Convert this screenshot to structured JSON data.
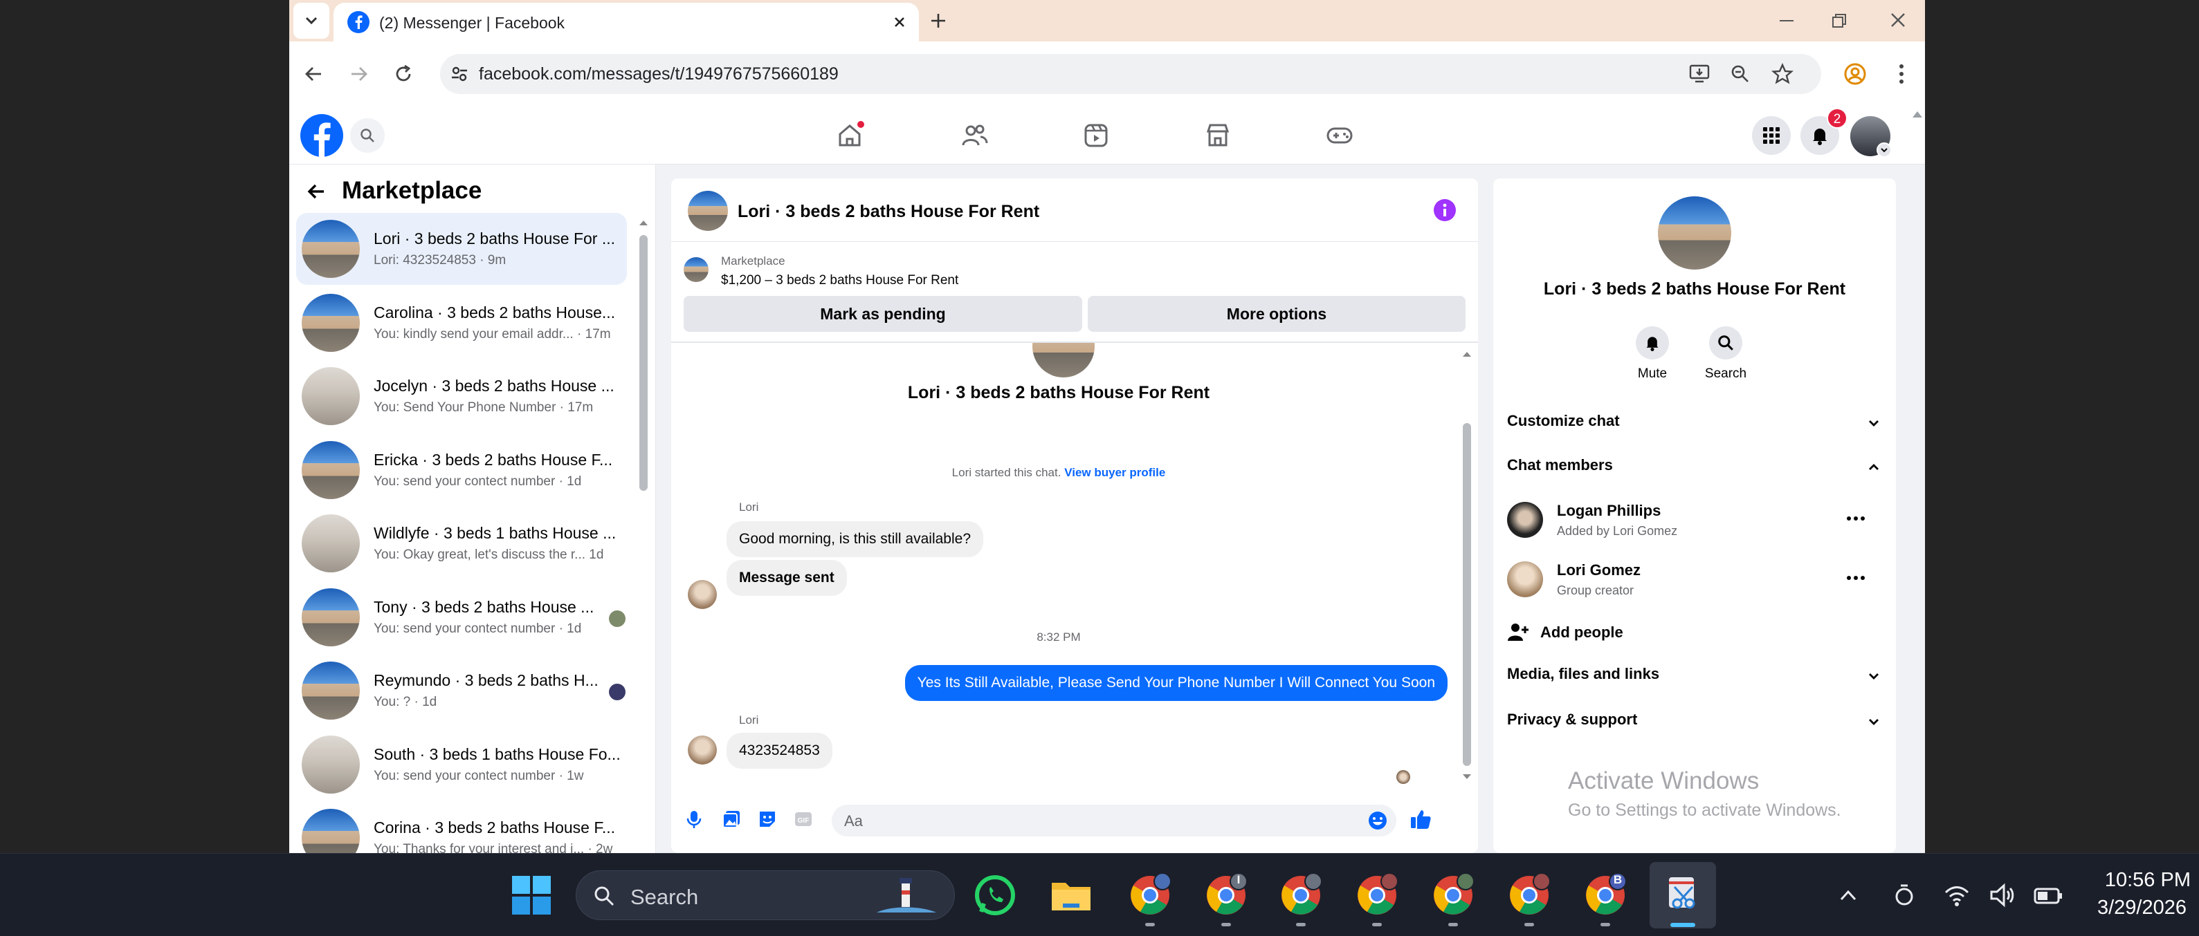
{
  "browser": {
    "tab_title": "(2) Messenger | Facebook",
    "url": "facebook.com/messages/t/1949767575660189"
  },
  "fb": {
    "notification_count": "2"
  },
  "sidebar": {
    "title": "Marketplace",
    "conversations": [
      {
        "title": "Lori · 3 beds 2 baths House For ...",
        "preview": "Lori: 4323524853 · 9m",
        "thumb": "house"
      },
      {
        "title": "Carolina · 3 beds 2 baths House...",
        "preview": "You: kindly send your email addr... · 17m",
        "thumb": "house"
      },
      {
        "title": "Jocelyn · 3 beds 2 baths House ...",
        "preview": "You: Send Your Phone Number · 17m",
        "thumb": "room"
      },
      {
        "title": "Ericka · 3 beds 2 baths House F...",
        "preview": "You: send your contect number · 1d",
        "thumb": "house"
      },
      {
        "title": "Wildlyfe · 3 beds 1 baths House ...",
        "preview": "You: Okay great, let's discuss the r...   1d",
        "thumb": "room"
      },
      {
        "title": "Tony · 3 beds 2 baths House ...",
        "preview": "You: send your contect number · 1d",
        "thumb": "house"
      },
      {
        "title": "Reymundo · 3 beds 2 baths H...",
        "preview": "You: ? · 1d",
        "thumb": "house"
      },
      {
        "title": "South · 3 beds 1 baths House Fo...",
        "preview": "You: send your contect number · 1w",
        "thumb": "room"
      },
      {
        "title": "Corina · 3 beds 2 baths House F...",
        "preview": "You: Thanks for your interest and i... · 2w",
        "thumb": "house"
      }
    ]
  },
  "chat": {
    "header_title": "Lori · 3 beds 2 baths House For Rent",
    "listing_label": "Marketplace",
    "listing_detail": "$1,200 – 3 beds 2 baths House For Rent",
    "mark_pending": "Mark as pending",
    "more_options": "More options",
    "intro_title": "Lori · 3 beds 2 baths House For Rent",
    "started_text": "Lori started this chat.",
    "view_profile": "View buyer profile",
    "sender1": "Lori",
    "msg1": "Good morning, is this still available?",
    "msg2": "Message sent",
    "timestamp": "8:32 PM",
    "msg3": "Yes Its Still Available, Please Send Your Phone Number I Will Connect You Soon",
    "sender2": "Lori",
    "msg4": "4323524853",
    "composer_placeholder": "Aa"
  },
  "info": {
    "title": "Lori · 3 beds 2 baths House For Rent",
    "mute": "Mute",
    "search": "Search",
    "customize": "Customize chat",
    "members_heading": "Chat members",
    "members": [
      {
        "name": "Logan Phillips",
        "sub": "Added by Lori Gomez"
      },
      {
        "name": "Lori Gomez",
        "sub": "Group creator"
      }
    ],
    "add_people": "Add people",
    "media": "Media, files and links",
    "privacy": "Privacy & support",
    "activate_title": "Activate Windows",
    "activate_sub": "Go to Settings to activate Windows."
  },
  "taskbar": {
    "search_placeholder": "Search",
    "time": "10:56 PM",
    "date": "3/29/2026",
    "chrome_badges": [
      "I",
      "",
      "",
      "",
      "",
      "B"
    ]
  }
}
